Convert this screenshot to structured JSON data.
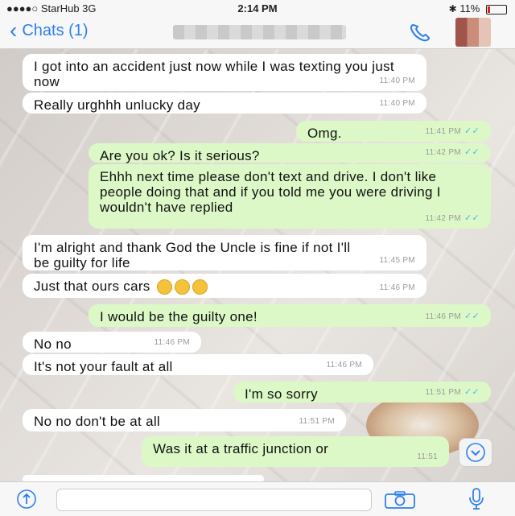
{
  "status_bar": {
    "carrier": "●●●●○ StarHub 3G",
    "time": "2:14 PM",
    "battery": "11%"
  },
  "nav": {
    "back_label": "Chats (1)"
  },
  "messages": [
    {
      "dir": "in",
      "text": "I got into an accident just now while I was texting you just now",
      "time": "11:40 PM"
    },
    {
      "dir": "in",
      "text": "Really urghhh unlucky day",
      "time": "11:40 PM"
    },
    {
      "dir": "out",
      "text": "Omg.",
      "time": "11:41 PM"
    },
    {
      "dir": "out",
      "text": "Are you ok? Is it serious?",
      "time": "11:42 PM"
    },
    {
      "dir": "out",
      "text": "Ehhh next time please don't text and drive. I don't like people doing that and if you told me you were driving I wouldn't have replied",
      "time": "11:42 PM"
    },
    {
      "dir": "in",
      "text": "I'm alright and thank God the Uncle is fine if not I'll be guilty for life",
      "time": "11:45 PM"
    },
    {
      "dir": "in",
      "text": "Just that ours cars",
      "time": "11:46 PM"
    },
    {
      "dir": "out",
      "text": "I would be the guilty one!",
      "time": "11:46 PM"
    },
    {
      "dir": "in",
      "text": "No no",
      "time": "11:46 PM"
    },
    {
      "dir": "in",
      "text": "It's not your fault at all",
      "time": "11:46 PM"
    },
    {
      "dir": "out",
      "text": "I'm so sorry",
      "time": "11:51 PM"
    },
    {
      "dir": "in",
      "text": "No no don't be at all",
      "time": "11:51 PM"
    },
    {
      "dir": "out",
      "text": "Was it at a traffic junction or",
      "time": "11:51"
    }
  ],
  "icons": {
    "back": "chevron-left-icon",
    "call": "phone-icon",
    "scroll": "chevron-down-icon",
    "attach": "share-icon",
    "camera": "camera-icon",
    "mic": "microphone-icon",
    "read": "double-check-icon"
  },
  "colors": {
    "accent": "#2d7ff0",
    "outgoing_bubble": "#dcf8c6",
    "incoming_bubble": "#ffffff",
    "read_ticks": "#4fb6ec",
    "battery_low": "#e02020"
  }
}
